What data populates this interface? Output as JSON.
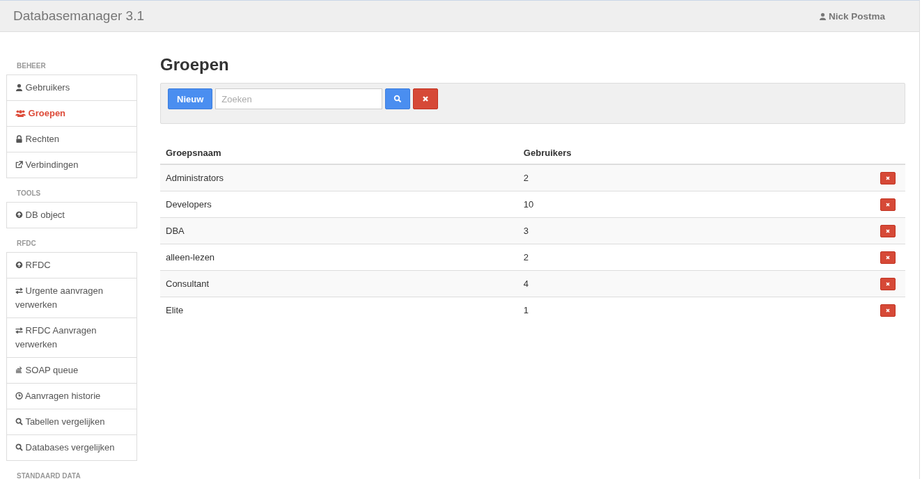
{
  "header": {
    "title": "Databasemanager 3.1",
    "user": "Nick Postma"
  },
  "sidebar": {
    "sections": [
      {
        "heading": "BEHEER",
        "items": [
          {
            "label": "Gebruikers",
            "kind": "user",
            "selected": false
          },
          {
            "label": "Groepen",
            "kind": "users",
            "selected": true
          },
          {
            "label": "Rechten",
            "kind": "lock",
            "selected": false
          },
          {
            "label": "Verbindingen",
            "kind": "external",
            "selected": false
          }
        ]
      },
      {
        "heading": "TOOLS",
        "items": [
          {
            "label": "DB object",
            "kind": "circle-up",
            "selected": false
          }
        ]
      },
      {
        "heading": "RFDC",
        "items": [
          {
            "label": "RFDC",
            "kind": "circle-up",
            "selected": false
          },
          {
            "label": "Urgente aanvragen verwerken",
            "kind": "swap",
            "selected": false
          },
          {
            "label": "RFDC Aanvragen verwerken",
            "kind": "swap",
            "selected": false
          },
          {
            "label": "SOAP queue",
            "kind": "stack",
            "selected": false
          },
          {
            "label": "Aanvragen historie",
            "kind": "clock",
            "selected": false
          },
          {
            "label": "Tabellen vergelijken",
            "kind": "search",
            "selected": false
          },
          {
            "label": "Databases vergelijken",
            "kind": "search",
            "selected": false
          }
        ]
      },
      {
        "heading": "STANDAARD DATA"
      }
    ]
  },
  "page": {
    "title": "Groepen",
    "new_button": "Nieuw",
    "search": {
      "placeholder": "Zoeken"
    }
  },
  "table": {
    "columns": [
      "Groepsnaam",
      "Gebruikers"
    ],
    "rows": [
      {
        "name": "Administrators",
        "users": "2"
      },
      {
        "name": "Developers",
        "users": "10"
      },
      {
        "name": "DBA",
        "users": "3"
      },
      {
        "name": "alleen-lezen",
        "users": "2"
      },
      {
        "name": "Consultant",
        "users": "4"
      },
      {
        "name": "Elite",
        "users": "1"
      }
    ]
  }
}
